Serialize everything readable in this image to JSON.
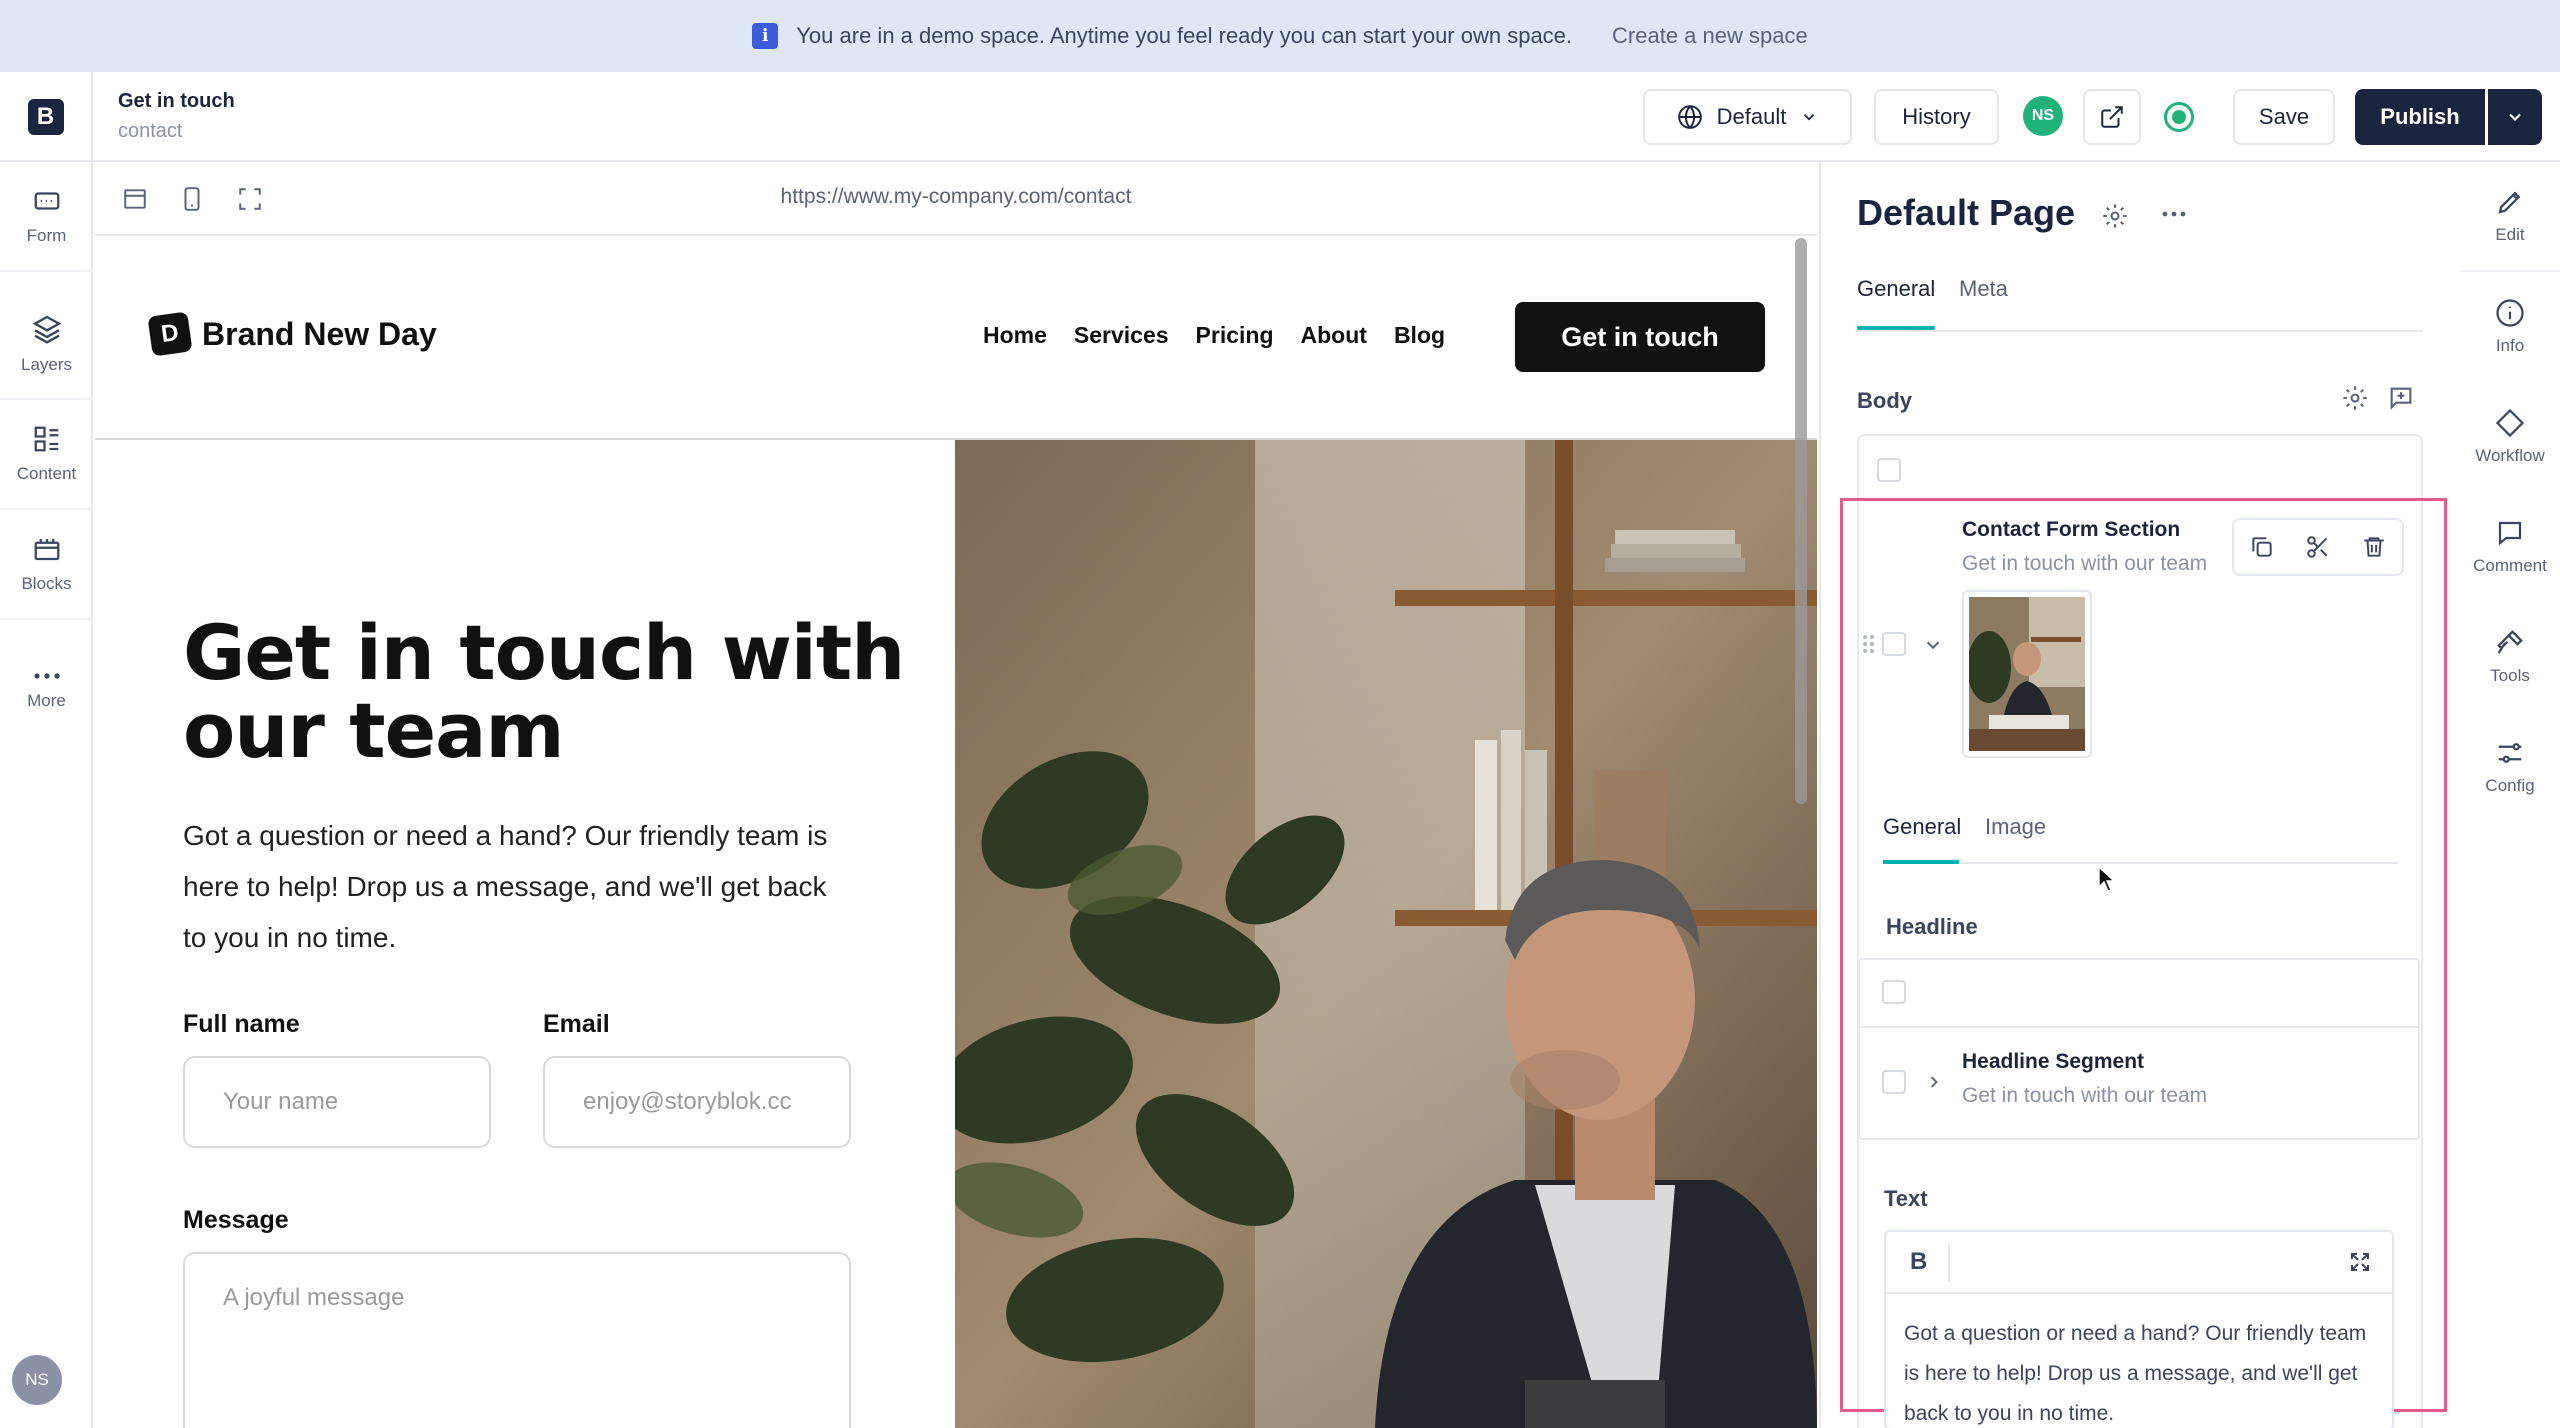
{
  "banner": {
    "info_icon_letter": "i",
    "message": "You are in a demo space. Anytime you feel ready you can start your own space.",
    "link": "Create a new space"
  },
  "header": {
    "logo_letter": "B",
    "story_title": "Get in touch",
    "story_slug": "contact",
    "language": "Default",
    "history": "History",
    "user_initials": "NS",
    "save": "Save",
    "publish": "Publish"
  },
  "left_nav": {
    "items": [
      {
        "label": "Form",
        "icon": "form-icon"
      },
      {
        "label": "Layers",
        "icon": "layers-icon"
      },
      {
        "label": "Content",
        "icon": "content-icon"
      },
      {
        "label": "Blocks",
        "icon": "blocks-icon"
      },
      {
        "label": "More",
        "icon": "more-icon"
      }
    ],
    "user_initials": "NS"
  },
  "preview": {
    "url": "https://www.my-company.com/contact",
    "site": {
      "brand_letter": "D",
      "brand": "Brand New Day",
      "nav": [
        "Home",
        "Services",
        "Pricing",
        "About",
        "Blog"
      ],
      "cta": "Get in touch",
      "headline": "Get in touch with our team",
      "paragraph": "Got a question or need a hand? Our friendly team is here to help! Drop us a message, and we'll get back to you in no time.",
      "form": {
        "fullname_label": "Full name",
        "fullname_placeholder": "Your name",
        "email_label": "Email",
        "email_placeholder": "enjoy@storyblok.cc",
        "message_label": "Message",
        "message_placeholder": "A joyful message"
      }
    }
  },
  "panel": {
    "title": "Default Page",
    "tabs": [
      "General",
      "Meta"
    ],
    "body_label": "Body",
    "component": {
      "title": "Contact Form Section",
      "subtitle": "Get in touch with our team",
      "inner_tabs": [
        "General",
        "Image"
      ],
      "headline_label": "Headline",
      "headline_segment_title": "Headline Segment",
      "headline_segment_subtitle": "Get in touch with our team",
      "text_label": "Text",
      "bold_button": "B",
      "text_value": "Got a question or need a hand? Our friendly team is here to help! Drop us a message, and we'll get back to you in no time."
    }
  },
  "right_rail": {
    "items": [
      {
        "label": "Edit",
        "icon": "pencil-icon"
      },
      {
        "label": "Info",
        "icon": "info-icon"
      },
      {
        "label": "Workflow",
        "icon": "diamond-icon"
      },
      {
        "label": "Comment",
        "icon": "comment-icon"
      },
      {
        "label": "Tools",
        "icon": "hammer-icon"
      },
      {
        "label": "Config",
        "icon": "sliders-icon"
      }
    ]
  },
  "colors": {
    "banner_bg": "#dfe6f6",
    "primary_dark": "#1b243f",
    "accent_teal": "#00b3b0",
    "status_green": "#1fb37a",
    "selection_pink": "#e55a8a"
  }
}
